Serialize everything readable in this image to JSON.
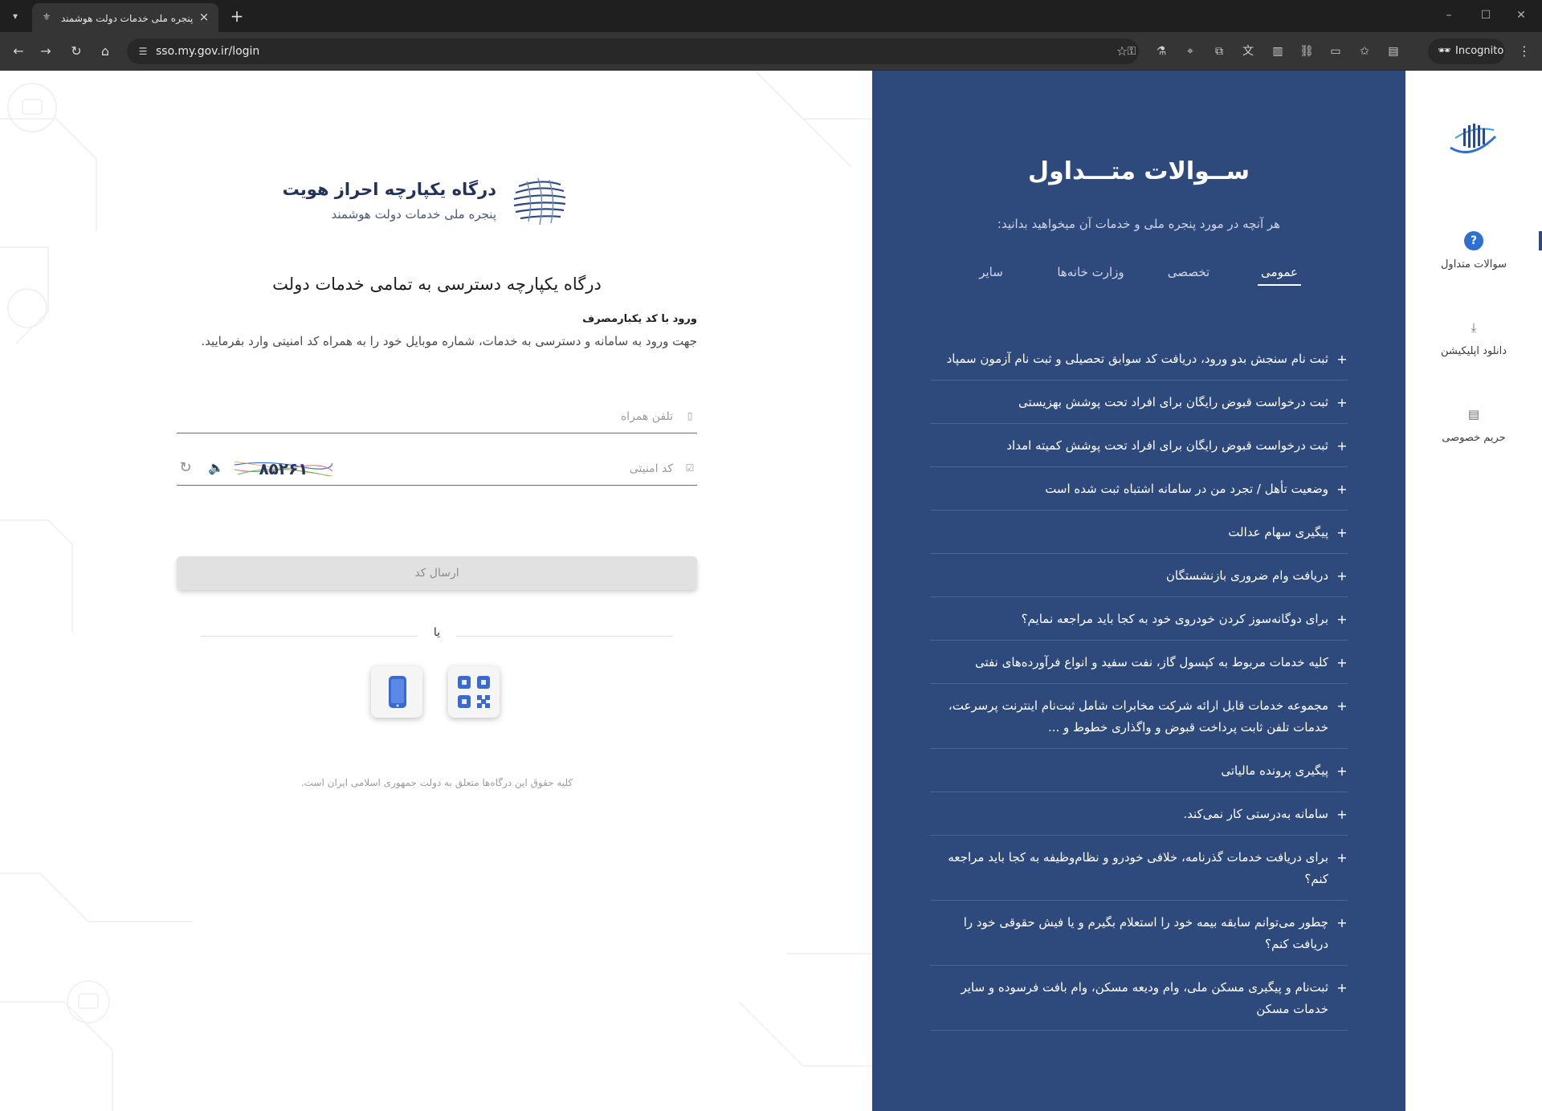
{
  "browser": {
    "tab_title": "پنجره ملی خدمات دولت هوشمند",
    "url": "sso.my.gov.ir/login",
    "incognito_label": "Incognito"
  },
  "login": {
    "brand_title": "درگاه یکپارچه احراز هویت",
    "brand_subtitle": "پنجره ملی خدمات دولت هوشمند",
    "heading": "درگاه یکپارچه دسترسی به تمامی خدمات دولت",
    "method_label": "ورود با کد یکبارمصرف",
    "description": "جهت ورود به سامانه و دسترسی به خدمات، شماره موبایل خود را به همراه کد امنیتی وارد بفرمایید.",
    "phone_placeholder": "تلفن همراه",
    "captcha_placeholder": "کد امنیتی",
    "captcha_text": "۸۵۲۶۱",
    "send_button": "ارسال کد",
    "or_text": "یا",
    "copyright": "کلیه حقوق این درگاه‌ها متعلق به دولت جمهوری اسلامی ایران است."
  },
  "faq": {
    "title": "ســوالات متـــداول",
    "subtitle": "هر آنچه در مورد پنجره ملی و خدمات آن میخواهید بدانید:",
    "tabs": [
      {
        "label": "عمومی",
        "active": true
      },
      {
        "label": "تخصصی",
        "active": false
      },
      {
        "label": "وزارت خانه‌ها",
        "active": false
      },
      {
        "label": "سایر",
        "active": false
      }
    ],
    "items": [
      "ثبت نام سنجش بدو ورود، دریافت کد سوابق تحصیلی و ثبت نام آزمون سمپاد",
      "ثبت درخواست قبوض رایگان برای افراد تحت پوشش بهزیستی",
      "ثبت درخواست قبوض رایگان برای افراد تحت پوشش کمیته امداد",
      "وضعیت تأهل / تجرد من در سامانه اشتباه ثبت شده است",
      "پیگیری سهام عدالت",
      "دریافت وام ضروری بازنشستگان",
      "برای دوگانه‌سوز کردن خودروی خود به کجا باید مراجعه نمایم؟",
      "کلیه خدمات مربوط به کپسول گاز، نفت سفید و انواع فرآورده‌های نفتی",
      "مجموعه خدمات قابل ارائه شرکت مخابرات شامل ثبت‌نام اینترنت پرسرعت، خدمات تلفن ثابت پرداخت قبوض و واگذاری خطوط و ...",
      "پیگیری پرونده مالیاتی",
      "سامانه به‌درستی کار نمی‌کند.",
      "برای دریافت خدمات گذرنامه، خلافی خودرو و نظام‌وظیفه به کجا باید مراجعه کنم؟",
      "چطور می‌توانم سابقه بیمه خود را استعلام بگیرم و یا فیش حقوقی خود را دریافت کنم؟",
      "ثبت‌نام و پیگیری مسکن ملی، وام ودیعه مسکن، وام بافت فرسوده و سایر خدمات مسکن"
    ]
  },
  "sidebar": {
    "items": [
      {
        "label": "سوالات متداول",
        "icon": "question-icon"
      },
      {
        "label": "دانلود اپلیکیشن",
        "icon": "download-icon"
      },
      {
        "label": "حریم خصوصی",
        "icon": "privacy-icon"
      }
    ]
  },
  "colors": {
    "faq_panel": "#2e4a7d",
    "brand_text": "#24325a",
    "accent_blue": "#2e6fd0"
  }
}
